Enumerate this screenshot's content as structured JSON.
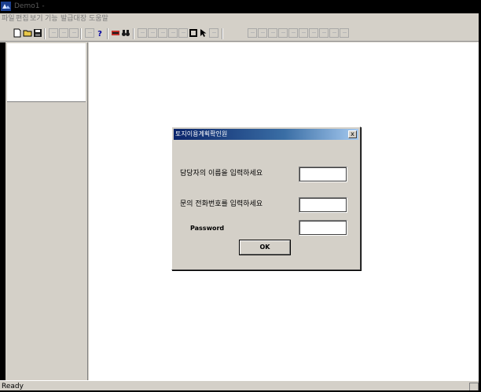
{
  "app": {
    "title": "Demo1 -"
  },
  "menu": {
    "items": [
      "파일",
      "편집",
      "보기",
      "기능",
      "발급대장",
      "도움말"
    ]
  },
  "toolbar": {
    "buttons": [
      {
        "icon": "new-file-icon"
      },
      {
        "icon": "open-folder-icon"
      },
      {
        "icon": "save-disk-icon"
      },
      {
        "icon": "cut-icon"
      },
      {
        "icon": "copy-icon"
      },
      {
        "icon": "paste-icon"
      },
      {
        "icon": "print-icon"
      },
      {
        "icon": "help-icon"
      },
      {
        "icon": "link-icon"
      },
      {
        "icon": "binoculars-icon"
      },
      {
        "icon": "draw-tool-icon"
      },
      {
        "icon": "zoom-in-icon"
      },
      {
        "icon": "line-tool-icon"
      },
      {
        "icon": "zoom-out-icon"
      },
      {
        "icon": "pen-tool-icon"
      },
      {
        "icon": "rectangle-tool-icon"
      },
      {
        "icon": "pointer-arrow-icon"
      },
      {
        "icon": "undo-icon"
      },
      {
        "icon": "shape-tool-icon"
      }
    ]
  },
  "dialog": {
    "title": "토지이용계획확인원",
    "close_glyph": "x",
    "name_label": "담당자의 이름을 입력하세요",
    "phone_label": "문의 전화번호를 입력하세요",
    "password_label": "Password",
    "name_value": "",
    "phone_value": "",
    "password_value": "",
    "ok_label": "OK"
  },
  "status": {
    "text": "Ready"
  },
  "colors": {
    "titlebar": "#000000",
    "dialog_title_start": "#0a246a",
    "dialog_title_end": "#a6caf0",
    "chrome": "#d4d0c8"
  }
}
